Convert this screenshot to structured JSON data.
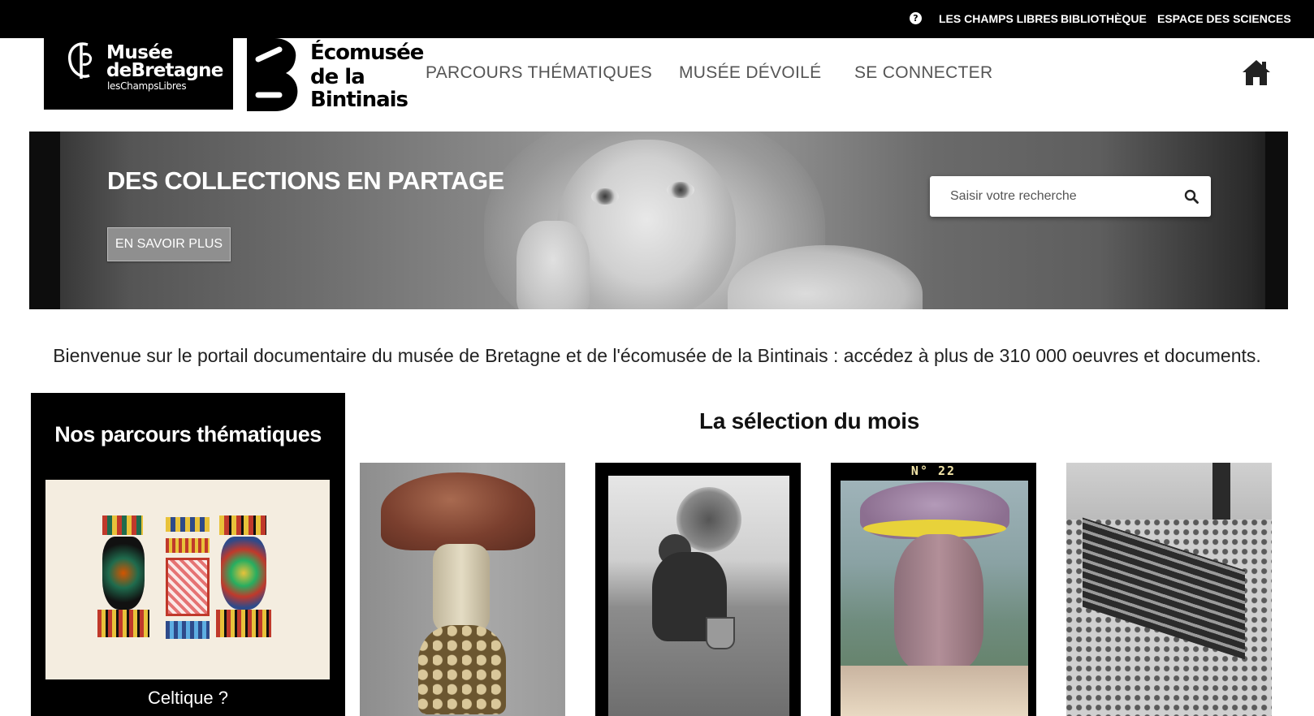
{
  "topbar": {
    "help_icon": "question-circle-icon",
    "links": [
      "LES CHAMPS LIBRES",
      "BIBLIOTHÈQUE",
      "ESPACE DES SCIENCES"
    ]
  },
  "header": {
    "logo1": {
      "line1": "Musée",
      "line2": "deBretagne",
      "line3": "lesChampsLibres"
    },
    "logo2": {
      "line1": "Écomusée",
      "line2": "de la",
      "line3": "Bintinais"
    },
    "nav": [
      "PARCOURS THÉMATIQUES",
      "MUSÉE DÉVOILÉ",
      "SE CONNECTER"
    ],
    "home_icon": "home-icon"
  },
  "hero": {
    "title": "DES COLLECTIONS EN PARTAGE",
    "button": "EN SAVOIR PLUS",
    "search_placeholder": "Saisir votre recherche",
    "search_icon": "search-icon"
  },
  "welcome": "Bienvenue sur le portail documentaire du musée de Bretagne et de l'écomusée de la Bintinais : accédez à plus de 310 000 oeuvres et documents.",
  "parcours": {
    "title": "Nos parcours thématiques",
    "caption": "Celtique ?"
  },
  "selection": {
    "title": "La sélection du mois",
    "card3_label": "N° 22"
  },
  "colors": {
    "black": "#000000",
    "nav_grey": "#555555",
    "button_grey": "#8f8f8f"
  }
}
